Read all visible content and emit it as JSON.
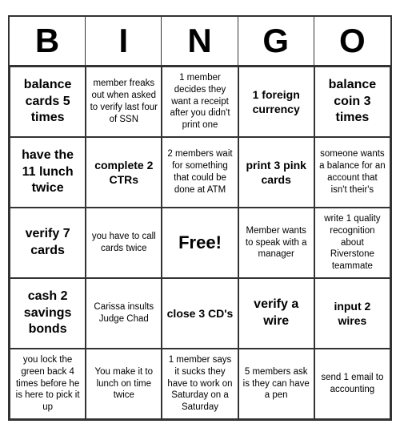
{
  "header": {
    "letters": [
      "B",
      "I",
      "N",
      "G",
      "O"
    ]
  },
  "cells": [
    {
      "text": "balance cards 5 times",
      "size": "large"
    },
    {
      "text": "member freaks out when asked to verify last four of SSN",
      "size": "small"
    },
    {
      "text": "1 member decides they want a receipt after you didn't print one",
      "size": "small"
    },
    {
      "text": "1 foreign currency",
      "size": "medium"
    },
    {
      "text": "balance coin 3 times",
      "size": "large"
    },
    {
      "text": "have the 11 lunch twice",
      "size": "large"
    },
    {
      "text": "complete 2 CTRs",
      "size": "medium"
    },
    {
      "text": "2 members wait for something that could be done at ATM",
      "size": "small"
    },
    {
      "text": "print 3 pink cards",
      "size": "medium"
    },
    {
      "text": "someone wants a balance for an account that isn't their's",
      "size": "small"
    },
    {
      "text": "verify 7 cards",
      "size": "large"
    },
    {
      "text": "you have to call cards twice",
      "size": "small"
    },
    {
      "text": "Free!",
      "size": "free"
    },
    {
      "text": "Member wants to speak with a manager",
      "size": "small"
    },
    {
      "text": "write 1 quality recognition about Riverstone teammate",
      "size": "small"
    },
    {
      "text": "cash 2 savings bonds",
      "size": "large"
    },
    {
      "text": "Carissa insults Judge Chad",
      "size": "small"
    },
    {
      "text": "close 3 CD's",
      "size": "medium"
    },
    {
      "text": "verify a wire",
      "size": "large"
    },
    {
      "text": "input 2 wires",
      "size": "medium"
    },
    {
      "text": "you lock the green back 4 times before he is here to pick it up",
      "size": "small"
    },
    {
      "text": "You make it to lunch on time twice",
      "size": "small"
    },
    {
      "text": "1 member says it sucks they have to work on Saturday on a Saturday",
      "size": "small"
    },
    {
      "text": "5 members ask is they can have a pen",
      "size": "small"
    },
    {
      "text": "send 1 email to accounting",
      "size": "small"
    }
  ]
}
